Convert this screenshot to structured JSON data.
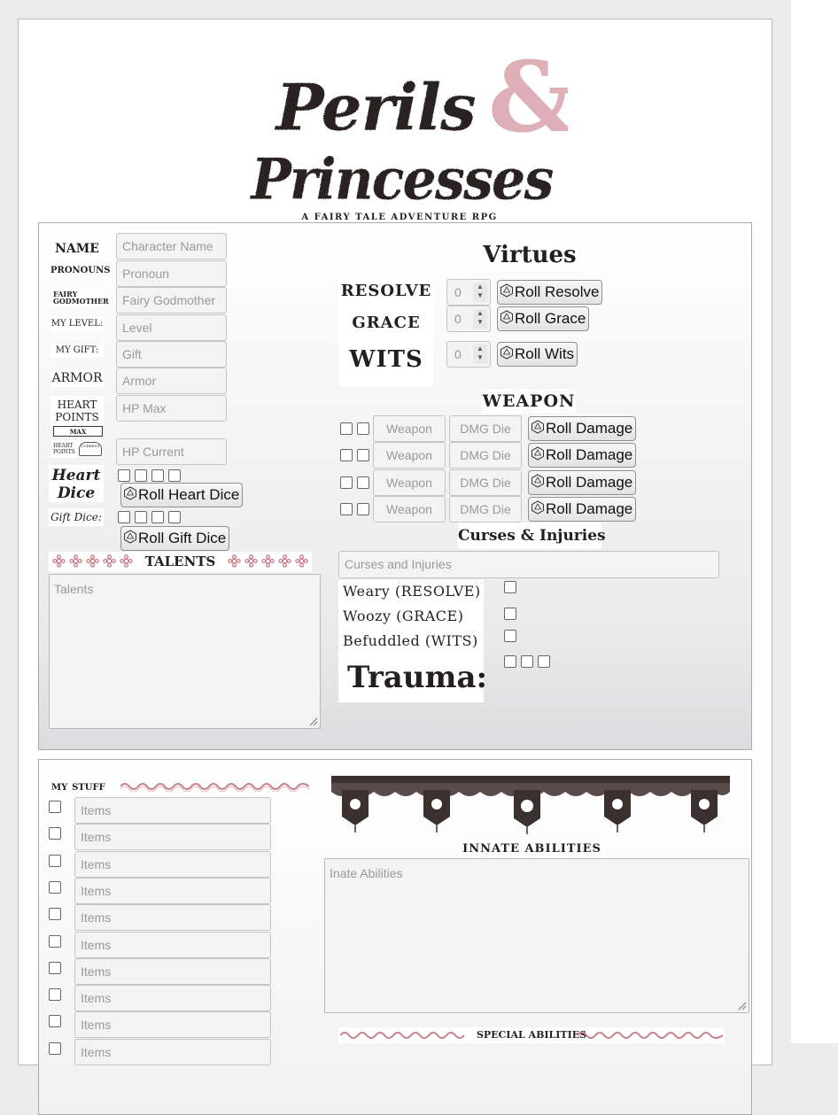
{
  "logo": {
    "title_line1": "Perils",
    "ampersand": "&",
    "title_line2": "Princesses",
    "tagline": "A FAIRY TALE ADVENTURE RPG",
    "colors": {
      "ink": "#2a2322",
      "accent": "#c97e8a"
    }
  },
  "character": {
    "name_label": "NAME",
    "pronouns_label": "PRONOUNS",
    "godmother_label_1": "FAIRY",
    "godmother_label_2": "GODMOTHER",
    "level_label": "MY LEVEL:",
    "gift_label": "MY GIFT:",
    "armor_label": "ARMOR",
    "heart_points_label_1": "HEART",
    "heart_points_label_2": "POINTS",
    "max_label": "MAX",
    "hp_current_label_1": "HEART",
    "hp_current_label_2": "POINTS",
    "current_label": "CURRENT",
    "fields": {
      "name_placeholder": "Character Name",
      "pronoun_placeholder": "Pronoun",
      "godmother_placeholder": "Fairy Godmother",
      "level_placeholder": "Level",
      "gift_placeholder": "Gift",
      "armor_placeholder": "Armor",
      "hp_max_placeholder": "HP Max",
      "hp_current_placeholder": "HP Current"
    },
    "heart_dice_label_1": "Heart",
    "heart_dice_label_2": "Dice",
    "roll_heart_dice": "Roll Heart Dice",
    "gift_dice_label": "Gift Dice:",
    "roll_gift_dice": "Roll Gift Dice",
    "talents_label": "TALENTS",
    "talents_placeholder": "Talents"
  },
  "virtues": {
    "heading": "Virtues",
    "resolve_label": "RESOLVE",
    "grace_label": "GRACE",
    "wits_label": "WITS",
    "resolve_value": "0",
    "grace_value": "0",
    "wits_value": "0",
    "roll_resolve": "Roll Resolve",
    "roll_grace": "Roll Grace",
    "roll_wits": "Roll Wits"
  },
  "weapons": {
    "heading": "WEAPON",
    "rows": [
      {
        "weapon_placeholder": "Weapon",
        "dmg_placeholder": "DMG Die",
        "roll": "Roll Damage"
      },
      {
        "weapon_placeholder": "Weapon",
        "dmg_placeholder": "DMG Die",
        "roll": "Roll Damage"
      },
      {
        "weapon_placeholder": "Weapon",
        "dmg_placeholder": "DMG Die",
        "roll": "Roll Damage"
      },
      {
        "weapon_placeholder": "Weapon",
        "dmg_placeholder": "DMG Die",
        "roll": "Roll Damage"
      }
    ]
  },
  "curses": {
    "heading": "Curses & Injuries",
    "placeholder": "Curses and Injuries",
    "weary_label": "Weary (RESOLVE)",
    "woozy_label": "Woozy (GRACE)",
    "befuddled_label": "Befuddled (WITS)",
    "trauma_label": "Trauma:"
  },
  "stuff": {
    "heading": "my stuff",
    "item_placeholder": "Items"
  },
  "innate": {
    "heading": "INNATE ABILITIES",
    "placeholder": "Inate Abilities"
  },
  "special": {
    "heading": "SPECIAL ABILITIES"
  }
}
